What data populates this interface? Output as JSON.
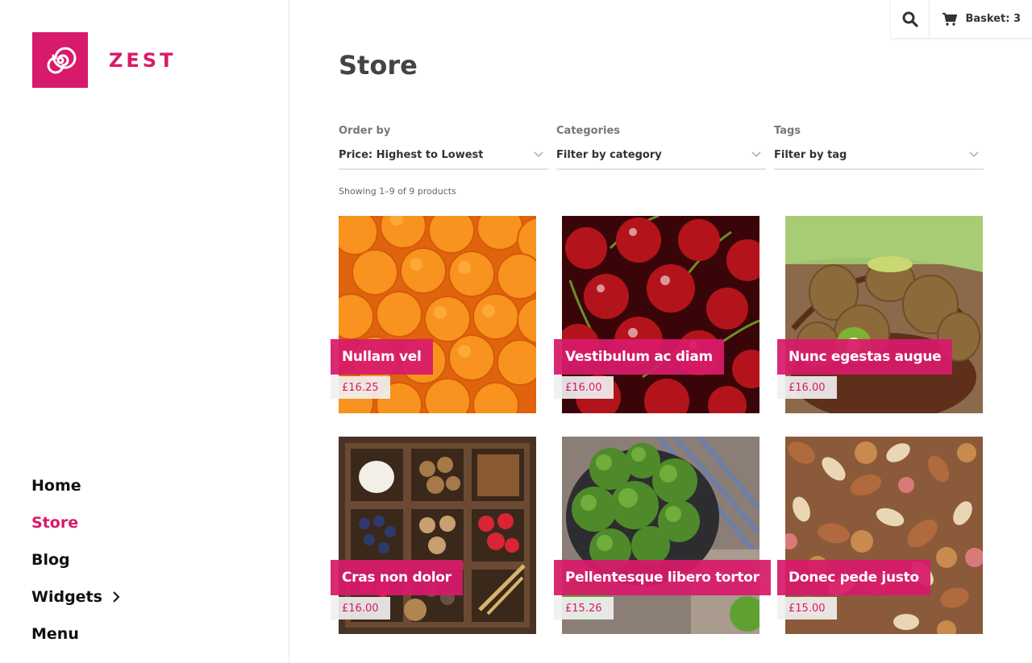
{
  "brand": {
    "name": "ZEST",
    "color": "#d81a6a"
  },
  "topbar": {
    "search_icon": "search-icon",
    "basket_label": "Basket: 3",
    "basket_icon": "cart-icon"
  },
  "nav": {
    "items": [
      {
        "label": "Home",
        "active": false
      },
      {
        "label": "Store",
        "active": true
      },
      {
        "label": "Blog",
        "active": false
      },
      {
        "label": "Widgets",
        "active": false,
        "has_submenu": true
      },
      {
        "label": "Menu",
        "active": false
      }
    ]
  },
  "page": {
    "title": "Store"
  },
  "filters": {
    "order": {
      "label": "Order by",
      "value": "Price: Highest to Lowest"
    },
    "categories": {
      "label": "Categories",
      "value": "Filter by category"
    },
    "tags": {
      "label": "Tags",
      "value": "Filter by tag"
    }
  },
  "result_count": "Showing 1–9 of 9 products",
  "products": [
    {
      "name": "Nullam vel",
      "price": "£16.25",
      "image": "oranges"
    },
    {
      "name": "Vestibulum ac diam",
      "price": "£16.00",
      "image": "cherries"
    },
    {
      "name": "Nunc egestas augue",
      "price": "£16.00",
      "image": "kiwis"
    },
    {
      "name": "Cras non dolor",
      "price": "£16.00",
      "image": "ingredients box"
    },
    {
      "name": "Pellentesque libero tortor",
      "price": "£15.26",
      "image": "broccoli"
    },
    {
      "name": "Donec pede justo",
      "price": "£15.00",
      "image": "mixed nuts"
    }
  ]
}
